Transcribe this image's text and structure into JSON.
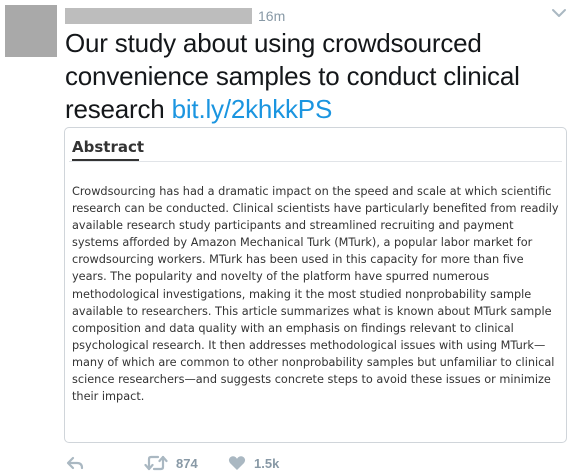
{
  "tweet": {
    "timestamp": "16m",
    "text": "Our study about using crowdsourced convenience samples to conduct clinical research ",
    "link": "bit.ly/2khkkPS"
  },
  "card": {
    "title": "Abstract",
    "body": "Crowdsourcing has had a dramatic impact on the speed and scale at which scientific research can be conducted. Clinical scientists have particularly benefited from readily available research study participants and streamlined recruiting and payment systems afforded by Amazon Mechanical Turk (MTurk), a popular labor market for crowdsourcing workers. MTurk has been used in this capacity for more than five years. The popularity and novelty of the platform have spurred numerous methodological investigations, making it the most studied nonprobability sample available to researchers. This article summarizes what is known about MTurk sample composition and data quality with an emphasis on findings relevant to clinical psychological research. It then addresses methodological issues with using MTurk—many of which are common to other nonprobability samples but unfamiliar to clinical science researchers—and suggests concrete steps to avoid these issues or minimize their impact."
  },
  "actions": {
    "retweet_count": "874",
    "like_count": "1.5k"
  },
  "icons": {
    "reply": "reply-icon",
    "retweet": "retweet-icon",
    "like": "heart-icon",
    "more": "chevron-down-icon"
  },
  "colors": {
    "link": "#1b95e0",
    "muted": "#8899a6",
    "text": "#14171a"
  }
}
